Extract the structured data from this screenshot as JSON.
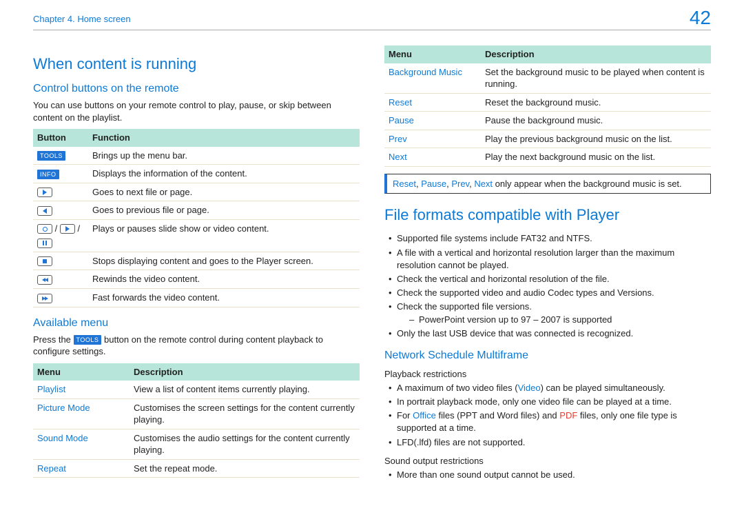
{
  "chapter": "Chapter 4. Home screen",
  "page_number": "42",
  "left": {
    "h1": "When content is running",
    "h2_control": "Control buttons on the remote",
    "p_control": "You can use buttons on your remote control to play, pause, or skip between content on the playlist.",
    "table_buttons": {
      "head": [
        "Button",
        "Function"
      ],
      "rows": [
        {
          "fn": "Brings up the menu bar."
        },
        {
          "fn": "Displays the information of the content."
        },
        {
          "fn": "Goes to next file or page."
        },
        {
          "fn": "Goes to previous file or page."
        },
        {
          "fn": "Plays or pauses slide show or video content."
        },
        {
          "fn": "Stops displaying content and goes to the Player screen."
        },
        {
          "fn": "Rewinds the video content."
        },
        {
          "fn": "Fast forwards the video content."
        }
      ],
      "tools_label": "TOOLS",
      "info_label": "INFO"
    },
    "h2_available": "Available menu",
    "p_available_prefix": "Press the ",
    "p_available_suffix": " button on the remote control during content playback to configure settings.",
    "table_menu": {
      "head": [
        "Menu",
        "Description"
      ],
      "rows": [
        {
          "menu": "Playlist",
          "desc": "View a list of content items currently playing."
        },
        {
          "menu": "Picture Mode",
          "desc": "Customises the screen settings for the content currently playing."
        },
        {
          "menu": "Sound Mode",
          "desc": "Customises the audio settings for the content currently playing."
        },
        {
          "menu": "Repeat",
          "desc": "Set the repeat mode."
        }
      ]
    }
  },
  "right": {
    "table_menu2": {
      "head": [
        "Menu",
        "Description"
      ],
      "rows": [
        {
          "menu": "Background Music",
          "desc": "Set the background music to be played when content is running."
        },
        {
          "menu": "Reset",
          "desc": "Reset the background music."
        },
        {
          "menu": "Pause",
          "desc": "Pause the background music."
        },
        {
          "menu": "Prev",
          "desc": "Play the previous background music on the list."
        },
        {
          "menu": "Next",
          "desc": "Play the next background music on the list."
        }
      ]
    },
    "note_terms": [
      "Reset",
      "Pause",
      "Prev",
      "Next"
    ],
    "note_suffix": " only appear when the background music is set.",
    "h1_formats": "File formats compatible with Player",
    "formats_bullets": [
      "Supported file systems include FAT32 and NTFS.",
      "A file with a vertical and horizontal resolution larger than the maximum resolution cannot be played.",
      "Check the vertical and horizontal resolution of the file.",
      "Check the supported video and audio Codec types and Versions.",
      "Check the supported file versions."
    ],
    "formats_dash": "PowerPoint version up to 97 – 2007 is supported",
    "formats_last": "Only the last USB device that was connected is recognized.",
    "h2_network": "Network Schedule Multiframe",
    "sub_playback": "Playback restrictions",
    "playback_bullets": {
      "b0_prefix": "A maximum of two video files (",
      "b0_video": "Video",
      "b0_suffix": ") can be played simultaneously.",
      "b1": "In portrait playback mode, only one video file can be played at a time.",
      "b2_prefix": "For ",
      "b2_office": "Office",
      "b2_mid": " files (PPT and Word files) and ",
      "b2_pdf": "PDF",
      "b2_suffix": " files, only one file type is supported at a time.",
      "b3": "LFD(.lfd) files are not supported."
    },
    "sub_sound": "Sound output restrictions",
    "sound_bullet": "More than one sound output cannot be used."
  }
}
